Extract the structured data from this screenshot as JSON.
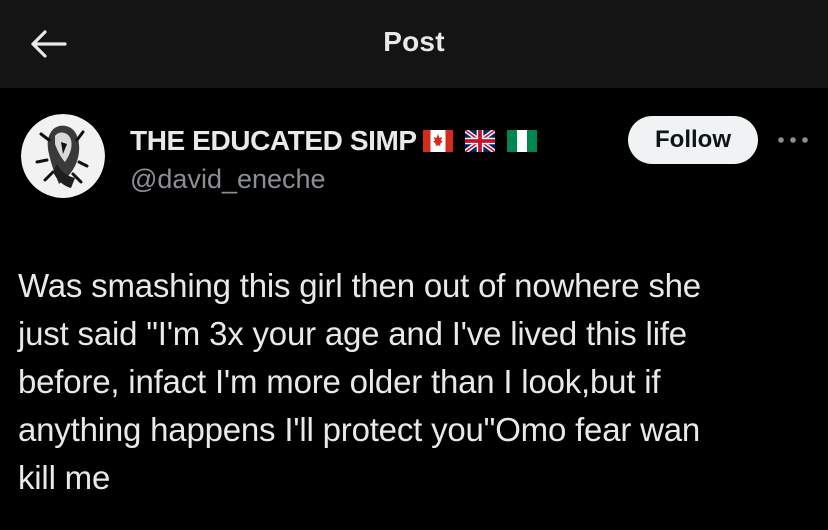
{
  "header": {
    "title": "Post",
    "back_icon": "arrow-left-icon"
  },
  "author": {
    "display_name": "THE EDUCATED SIMP",
    "flags": [
      "canada-flag-icon",
      "uk-flag-icon",
      "nigeria-flag-icon"
    ],
    "handle": "@david_eneche",
    "avatar_icon": "avatar-image"
  },
  "actions": {
    "follow_label": "Follow",
    "more_icon": "more-options-icon"
  },
  "post": {
    "text": "Was smashing this girl then out of nowhere she\njust said \"I'm 3x your age and I've lived this life\nbefore, infact I'm more older than I look,but if\nanything happens I'll protect you\"Omo fear wan\nkill me"
  },
  "colors": {
    "background": "#000000",
    "header_bg": "#141414",
    "text": "#e7e9ea",
    "secondary_text": "#8b8f94",
    "follow_bg": "#eff3f4"
  }
}
